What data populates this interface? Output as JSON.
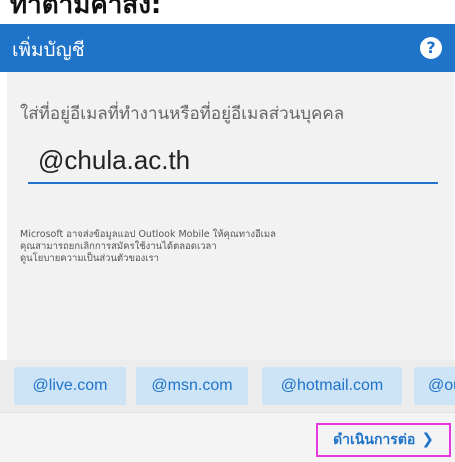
{
  "top_cut_text": "ทำตามคำสั่ง:",
  "header": {
    "title": "เพิ่มบัญชี",
    "help_icon": "question-circle-icon"
  },
  "main": {
    "prompt": "ใส่ที่อยู่อีเมลที่ทำงานหรือที่อยู่อีเมลส่วนบุคคล",
    "email_value": "@chula.ac.th",
    "disclaimer_lines": [
      "Microsoft อาจส่งข้อมูลแอป Outlook Mobile ให้คุณทางอีเมล",
      "คุณสามารถยกเลิกการสมัครใช้งานได้ตลอดเวลา",
      "ดูนโยบายความเป็นส่วนตัวของเรา"
    ]
  },
  "domain_chips": [
    "@live.com",
    "@msn.com",
    "@hotmail.com",
    "@outlook.com"
  ],
  "footer": {
    "continue_label": "ดำเนินการต่อ",
    "continue_icon": "chevron-right-icon"
  },
  "colors": {
    "accent": "#1f73c8",
    "chip_bg": "#cde4f7",
    "highlight_border": "#e63ae0"
  }
}
